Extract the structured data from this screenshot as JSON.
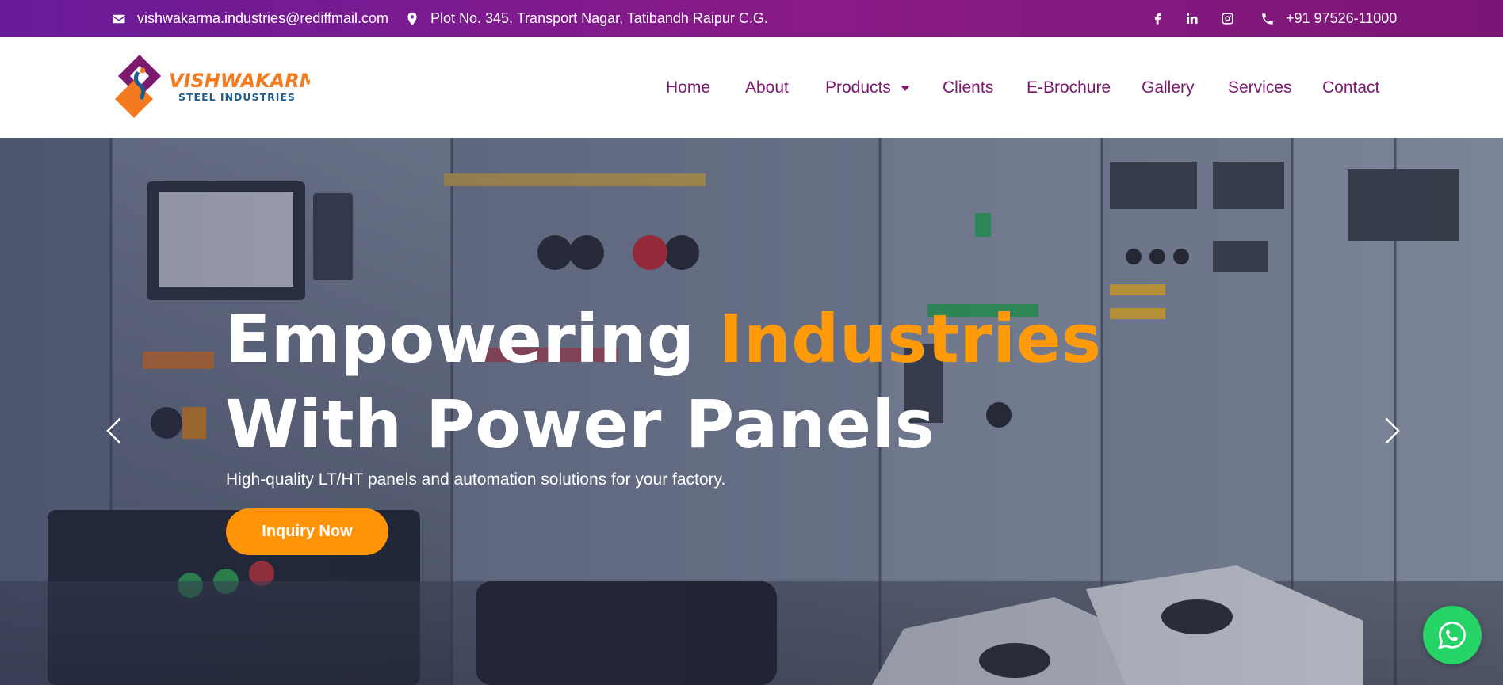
{
  "topbar": {
    "email": "vishwakarma.industries@rediffmail.com",
    "address": "Plot No. 345, Transport Nagar, Tatibandh Raipur C.G.",
    "phone": "+91 97526-11000",
    "icons": [
      "envelope-icon",
      "map-marker-icon",
      "facebook-icon",
      "linkedin-icon",
      "instagram-icon",
      "phone-icon"
    ],
    "background_colors": [
      "#6a1b9a",
      "#8a1a86"
    ]
  },
  "brand": {
    "name_line1": "VISHWAKARMA",
    "name_line2": "STEEL INDUSTRIES",
    "colors": {
      "primary": "#7b1a6e",
      "orange": "#f47a20",
      "blue": "#1d5c8c"
    }
  },
  "nav": {
    "items": [
      {
        "label": "Home"
      },
      {
        "label": "About"
      },
      {
        "label": "Products",
        "has_dropdown": true
      },
      {
        "label": "Clients"
      },
      {
        "label": "E-Brochure"
      },
      {
        "label": "Gallery"
      },
      {
        "label": "Services"
      },
      {
        "label": "Contact"
      }
    ],
    "link_color": "#7b1a6e"
  },
  "hero": {
    "title_word1": "Empowering",
    "title_accent": "Industries",
    "title_line2": "With Power Panels",
    "subtitle": "High-quality LT/HT panels and automation solutions for your factory.",
    "cta_label": "Inquiry Now",
    "accent_color": "#ff9a0a",
    "button_color": "#ff9408",
    "background_description_icons": [
      "chevron-left-icon",
      "chevron-right-icon"
    ]
  },
  "floating": {
    "whatsapp_icon": "whatsapp-icon",
    "color": "#25d366"
  }
}
